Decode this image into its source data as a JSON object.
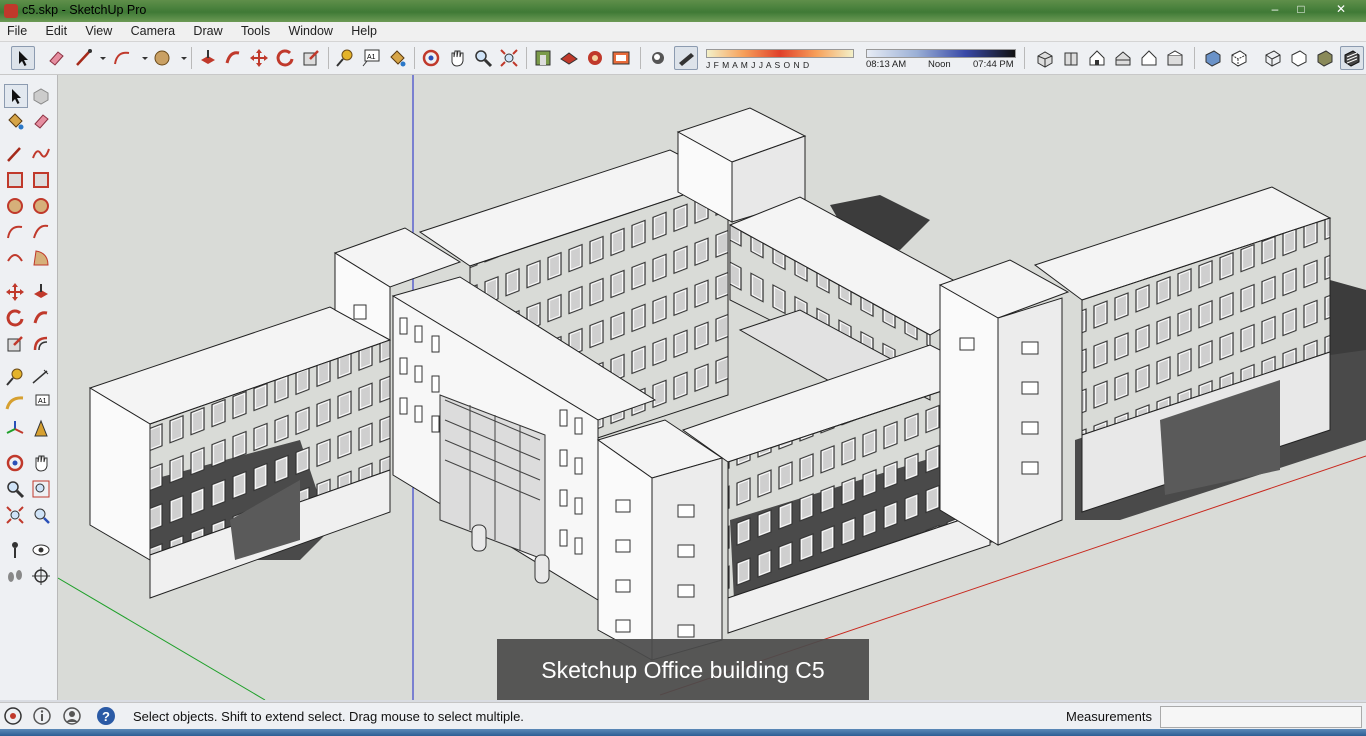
{
  "window": {
    "title": "c5.skp - SketchUp Pro",
    "minimize": "‒",
    "maximize": "□",
    "close": "✕"
  },
  "menu": [
    "File",
    "Edit",
    "View",
    "Camera",
    "Draw",
    "Tools",
    "Window",
    "Help"
  ],
  "shadow_settings": {
    "months": "J F M A M J J A S O N D",
    "time_start": "08:13 AM",
    "time_mid": "Noon",
    "time_end": "07:44 PM"
  },
  "viewport": {
    "caption": "Sketchup Office building C5"
  },
  "statusbar": {
    "message": "Select objects. Shift to extend select. Drag mouse to select multiple.",
    "measurements_label": "Measurements",
    "measurements_value": ""
  },
  "colors": {
    "axis_blue": "#1a24c8",
    "axis_red": "#c8281e",
    "axis_green": "#1fa02a",
    "background": "#d9dbd7",
    "face": "#f2f2f2"
  }
}
